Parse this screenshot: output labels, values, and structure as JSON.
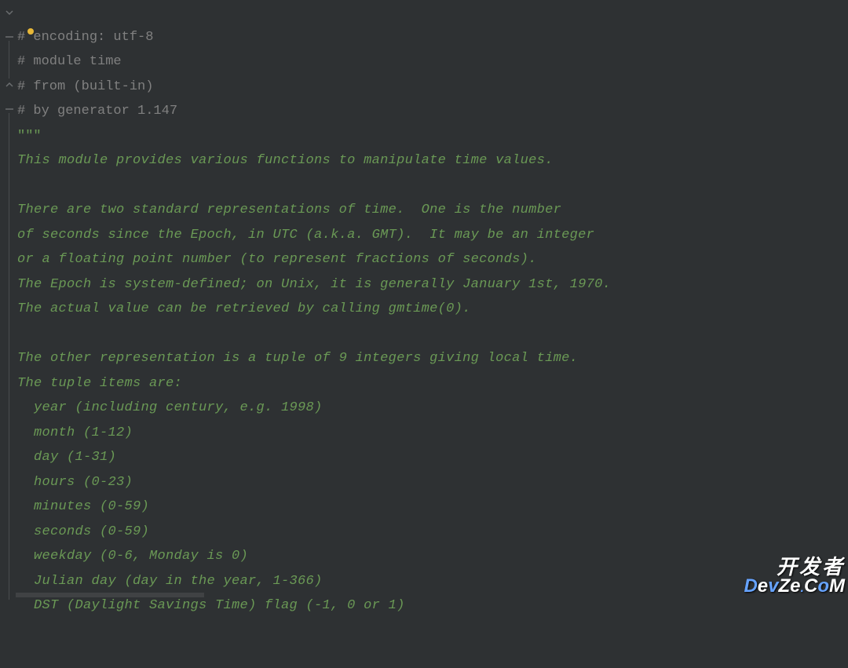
{
  "code": {
    "line1": "# encoding: utf-8",
    "line2": "# module time",
    "line3": "# from (built-in)",
    "line4": "# by generator 1.147",
    "line5": "\"\"\"",
    "line6": "This module provides various functions to manipulate time values.",
    "line7": "",
    "line8": "There are two standard representations of time.  One is the number",
    "line9": "of seconds since the Epoch, in UTC (a.k.a. GMT).  It may be an integer",
    "line10": "or a floating point number (to represent fractions of seconds).",
    "line11": "The Epoch is system-defined; on Unix, it is generally January 1st, 1970.",
    "line12": "The actual value can be retrieved by calling gmtime(0).",
    "line13": "",
    "line14": "The other representation is a tuple of 9 integers giving local time.",
    "line15": "The tuple items are:",
    "line16": "  year (including century, e.g. 1998)",
    "line17": "  month (1-12)",
    "line18": "  day (1-31)",
    "line19": "  hours (0-23)",
    "line20": "  minutes (0-59)",
    "line21": "  seconds (0-59)",
    "line22": "  weekday (0-6, Monday is 0)",
    "line23": "  Julian day (day in the year, 1-366)",
    "line24": "  DST (Daylight Savings Time) flag (-1, 0 or 1)"
  },
  "watermark": {
    "row1": "开发者",
    "row2": "DevZe.CoM"
  }
}
